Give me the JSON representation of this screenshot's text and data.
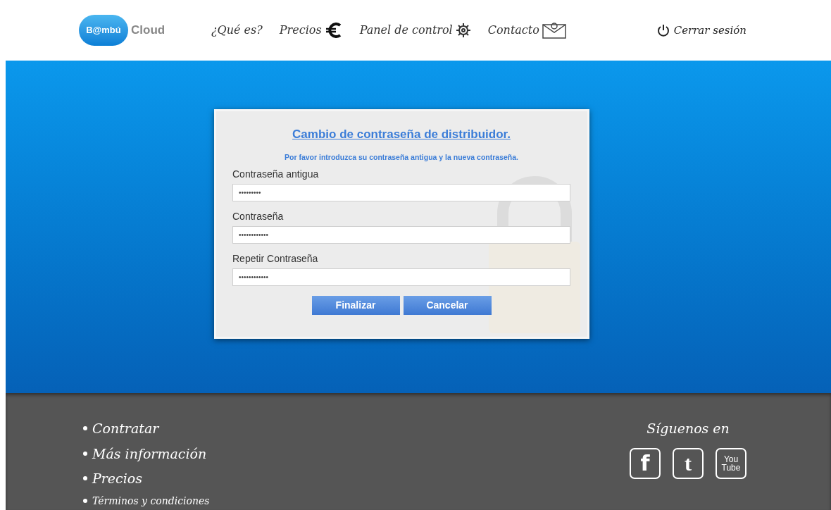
{
  "header": {
    "logo": {
      "badge": "B@mbú",
      "name": "Cloud"
    },
    "nav": [
      {
        "label": "¿Qué es?",
        "kind": "plain"
      },
      {
        "label": "Precios",
        "kind": "euro"
      },
      {
        "label": "Panel de control",
        "kind": "gear"
      },
      {
        "label": "Contacto",
        "kind": "mail"
      }
    ],
    "logout": "Cerrar sesión"
  },
  "form": {
    "title": "Cambio de contraseña de distribuidor.",
    "subtitle": "Por favor introduzca su contraseña antigua y la nueva contraseña.",
    "fields": [
      {
        "label": "Contraseña antigua",
        "value": "•••••••••"
      },
      {
        "label": "Contraseña",
        "value": "••••••••••••"
      },
      {
        "label": "Repetir Contraseña",
        "value": "••••••••••••"
      }
    ],
    "buttons": [
      "Finalizar",
      "Cancelar"
    ]
  },
  "footer": {
    "links": [
      {
        "label": "Contratar",
        "kind": "large"
      },
      {
        "label": "Más información",
        "kind": "large"
      },
      {
        "label": "Precios",
        "kind": "large"
      },
      {
        "label": "Términos y condiciones",
        "kind": "small"
      }
    ],
    "follow": "Síguenos en",
    "social": [
      {
        "kind": "facebook",
        "lines": [
          "f"
        ]
      },
      {
        "kind": "twitter",
        "lines": [
          "t"
        ]
      },
      {
        "kind": "youtube",
        "lines": [
          "You",
          "Tube"
        ]
      }
    ]
  }
}
